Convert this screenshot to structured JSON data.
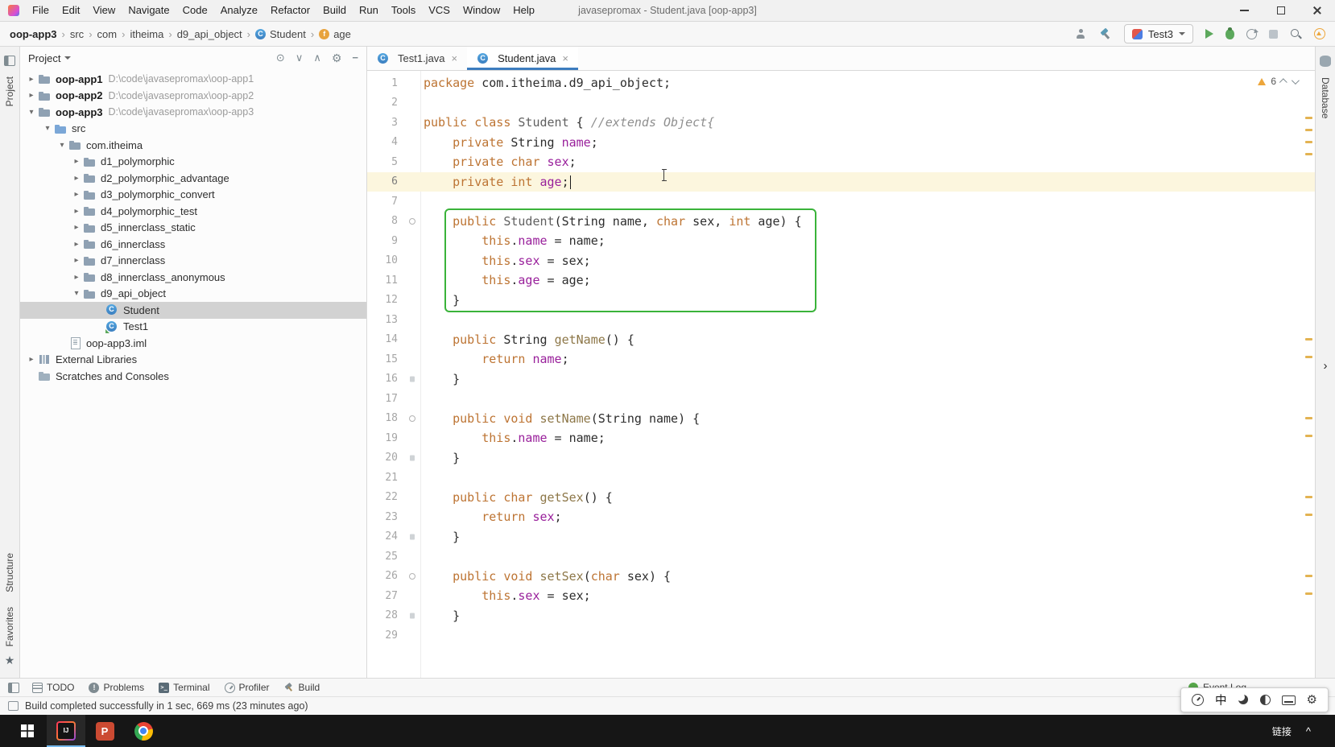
{
  "colors": {
    "keyword": "#bd7433",
    "field": "#99209b",
    "method": "#8d7748",
    "classname": "#606060",
    "comment": "#8f8f8f",
    "plain": "#2d2d2d",
    "box_green": "#3ab33a",
    "warning": "#eda63b",
    "run_green": "#5ca85c",
    "selection": "#d2d2d2",
    "tab_accent": "#3d7dbf",
    "current_line": "#fcf6de",
    "scroll_mark": "#e3b352"
  },
  "title_bar": {
    "menus": [
      "File",
      "Edit",
      "View",
      "Navigate",
      "Code",
      "Analyze",
      "Refactor",
      "Build",
      "Run",
      "Tools",
      "VCS",
      "Window",
      "Help"
    ],
    "title": "javasepromax - Student.java [oop-app3]"
  },
  "nav_bar": {
    "breadcrumbs": [
      {
        "label": "oop-app3",
        "bold": true
      },
      {
        "label": "src"
      },
      {
        "label": "com"
      },
      {
        "label": "itheima"
      },
      {
        "label": "d9_api_object"
      },
      {
        "label": "Student",
        "icon": "class"
      },
      {
        "label": "age",
        "icon": "field"
      }
    ],
    "run_config_label": "Test3"
  },
  "left_stripe": {
    "top_label": "Project",
    "bottom_labels": [
      "Structure",
      "Favorites"
    ]
  },
  "right_stripe": {
    "top_label": "Database"
  },
  "project_panel": {
    "title": "Project",
    "tree": [
      {
        "label": "oop-app1",
        "path": "D:\\code\\javasepromax\\oop-app1",
        "indent": 6,
        "chevron": "collapsed",
        "icon": "folder-project",
        "bold": true
      },
      {
        "label": "oop-app2",
        "path": "D:\\code\\javasepromax\\oop-app2",
        "indent": 6,
        "chevron": "collapsed",
        "icon": "folder-project",
        "bold": true
      },
      {
        "label": "oop-app3",
        "path": "D:\\code\\javasepromax\\oop-app3",
        "indent": 6,
        "chevron": "expanded",
        "icon": "folder-project",
        "bold": true
      },
      {
        "label": "src",
        "indent": 26,
        "chevron": "expanded",
        "icon": "folder-src"
      },
      {
        "label": "com.itheima",
        "indent": 44,
        "chevron": "expanded",
        "icon": "folder-package"
      },
      {
        "label": "d1_polymorphic",
        "indent": 62,
        "chevron": "collapsed",
        "icon": "folder-package"
      },
      {
        "label": "d2_polymorphic_advantage",
        "indent": 62,
        "chevron": "collapsed",
        "icon": "folder-package"
      },
      {
        "label": "d3_polymorphic_convert",
        "indent": 62,
        "chevron": "collapsed",
        "icon": "folder-package"
      },
      {
        "label": "d4_polymorphic_test",
        "indent": 62,
        "chevron": "collapsed",
        "icon": "folder-package"
      },
      {
        "label": "d5_innerclass_static",
        "indent": 62,
        "chevron": "collapsed",
        "icon": "folder-package"
      },
      {
        "label": "d6_innerclass",
        "indent": 62,
        "chevron": "collapsed",
        "icon": "folder-package"
      },
      {
        "label": "d7_innerclass",
        "indent": 62,
        "chevron": "collapsed",
        "icon": "folder-package"
      },
      {
        "label": "d8_innerclass_anonymous",
        "indent": 62,
        "chevron": "collapsed",
        "icon": "folder-package"
      },
      {
        "label": "d9_api_object",
        "indent": 62,
        "chevron": "expanded",
        "icon": "folder-package"
      },
      {
        "label": "Student",
        "indent": 90,
        "chevron": "none",
        "icon": "class",
        "selected": true
      },
      {
        "label": "Test1",
        "indent": 90,
        "chevron": "none",
        "icon": "class-runnable"
      },
      {
        "label": "oop-app3.iml",
        "indent": 44,
        "chevron": "none",
        "icon": "file-module"
      },
      {
        "label": "External Libraries",
        "indent": 6,
        "chevron": "collapsed",
        "icon": "libraries"
      },
      {
        "label": "Scratches and Consoles",
        "indent": 6,
        "chevron": "none",
        "icon": "scratches"
      }
    ]
  },
  "editor": {
    "tabs": [
      {
        "label": "Test1.java",
        "active": false
      },
      {
        "label": "Student.java",
        "active": true
      }
    ],
    "inspection_warnings": "6",
    "caret_line": 6,
    "highlight_box": {
      "first_line": 8,
      "last_line": 12
    },
    "gutter_marks": [
      {
        "line": 8,
        "type": "circle"
      },
      {
        "line": 16,
        "type": "small"
      },
      {
        "line": 18,
        "type": "circle"
      },
      {
        "line": 20,
        "type": "small"
      },
      {
        "line": 24,
        "type": "small"
      },
      {
        "line": 26,
        "type": "circle"
      },
      {
        "line": 28,
        "type": "small"
      }
    ],
    "scrollbar_marks": [
      7.5,
      9.5,
      11.5,
      13.5,
      44,
      47,
      57,
      60,
      70,
      73,
      83,
      86
    ],
    "code_lines": [
      [
        [
          "k",
          "package"
        ],
        [
          "p",
          " com.itheima.d9_api_object;"
        ]
      ],
      [],
      [
        [
          "k",
          "public"
        ],
        [
          "p",
          " "
        ],
        [
          "k",
          "class"
        ],
        [
          "p",
          " "
        ],
        [
          "cl",
          "Student"
        ],
        [
          "p",
          " { "
        ],
        [
          "cm",
          "//extends Object{"
        ]
      ],
      [
        [
          "p",
          "    "
        ],
        [
          "k",
          "private"
        ],
        [
          "p",
          " String "
        ],
        [
          "f",
          "name"
        ],
        [
          "p",
          ";"
        ]
      ],
      [
        [
          "p",
          "    "
        ],
        [
          "k",
          "private"
        ],
        [
          "p",
          " "
        ],
        [
          "k",
          "char"
        ],
        [
          "p",
          " "
        ],
        [
          "f",
          "sex"
        ],
        [
          "p",
          ";"
        ]
      ],
      [
        [
          "p",
          "    "
        ],
        [
          "k",
          "private"
        ],
        [
          "p",
          " "
        ],
        [
          "k",
          "int"
        ],
        [
          "p",
          " "
        ],
        [
          "f",
          "age"
        ],
        [
          "p",
          ";"
        ]
      ],
      [],
      [
        [
          "p",
          "    "
        ],
        [
          "k",
          "public"
        ],
        [
          "p",
          " "
        ],
        [
          "cl",
          "Student"
        ],
        [
          "p",
          "(String name, "
        ],
        [
          "k",
          "char"
        ],
        [
          "p",
          " sex, "
        ],
        [
          "k",
          "int"
        ],
        [
          "p",
          " age) {"
        ]
      ],
      [
        [
          "p",
          "        "
        ],
        [
          "k",
          "this"
        ],
        [
          "p",
          "."
        ],
        [
          "f",
          "name"
        ],
        [
          "p",
          " = name;"
        ]
      ],
      [
        [
          "p",
          "        "
        ],
        [
          "k",
          "this"
        ],
        [
          "p",
          "."
        ],
        [
          "f",
          "sex"
        ],
        [
          "p",
          " = sex;"
        ]
      ],
      [
        [
          "p",
          "        "
        ],
        [
          "k",
          "this"
        ],
        [
          "p",
          "."
        ],
        [
          "f",
          "age"
        ],
        [
          "p",
          " = age;"
        ]
      ],
      [
        [
          "p",
          "    }"
        ]
      ],
      [],
      [
        [
          "p",
          "    "
        ],
        [
          "k",
          "public"
        ],
        [
          "p",
          " String "
        ],
        [
          "m",
          "getName"
        ],
        [
          "p",
          "() {"
        ]
      ],
      [
        [
          "p",
          "        "
        ],
        [
          "k",
          "return"
        ],
        [
          "p",
          " "
        ],
        [
          "f",
          "name"
        ],
        [
          "p",
          ";"
        ]
      ],
      [
        [
          "p",
          "    }"
        ]
      ],
      [],
      [
        [
          "p",
          "    "
        ],
        [
          "k",
          "public"
        ],
        [
          "p",
          " "
        ],
        [
          "k",
          "void"
        ],
        [
          "p",
          " "
        ],
        [
          "m",
          "setName"
        ],
        [
          "p",
          "(String name) {"
        ]
      ],
      [
        [
          "p",
          "        "
        ],
        [
          "k",
          "this"
        ],
        [
          "p",
          "."
        ],
        [
          "f",
          "name"
        ],
        [
          "p",
          " = name;"
        ]
      ],
      [
        [
          "p",
          "    }"
        ]
      ],
      [],
      [
        [
          "p",
          "    "
        ],
        [
          "k",
          "public"
        ],
        [
          "p",
          " "
        ],
        [
          "k",
          "char"
        ],
        [
          "p",
          " "
        ],
        [
          "m",
          "getSex"
        ],
        [
          "p",
          "() {"
        ]
      ],
      [
        [
          "p",
          "        "
        ],
        [
          "k",
          "return"
        ],
        [
          "p",
          " "
        ],
        [
          "f",
          "sex"
        ],
        [
          "p",
          ";"
        ]
      ],
      [
        [
          "p",
          "    }"
        ]
      ],
      [],
      [
        [
          "p",
          "    "
        ],
        [
          "k",
          "public"
        ],
        [
          "p",
          " "
        ],
        [
          "k",
          "void"
        ],
        [
          "p",
          " "
        ],
        [
          "m",
          "setSex"
        ],
        [
          "p",
          "("
        ],
        [
          "k",
          "char"
        ],
        [
          "p",
          " sex) {"
        ]
      ],
      [
        [
          "p",
          "        "
        ],
        [
          "k",
          "this"
        ],
        [
          "p",
          "."
        ],
        [
          "f",
          "sex"
        ],
        [
          "p",
          " = sex;"
        ]
      ],
      [
        [
          "p",
          "    }"
        ]
      ],
      []
    ]
  },
  "tool_bar": {
    "items": [
      {
        "label": "TODO",
        "icon": "todo"
      },
      {
        "label": "Problems",
        "icon": "problems"
      },
      {
        "label": "Terminal",
        "icon": "terminal"
      },
      {
        "label": "Profiler",
        "icon": "profiler"
      },
      {
        "label": "Build",
        "icon": "build"
      }
    ],
    "event_log_label": "Event Log"
  },
  "status_bar": {
    "message": "Build completed successfully in 1 sec, 669 ms (23 minutes ago)"
  },
  "taskbar": {
    "idea_label": "IJ",
    "ppt_label": "P",
    "tray_label": "链接",
    "tray_chevron": "^"
  },
  "ime_bar": {
    "mode_label": "中"
  }
}
